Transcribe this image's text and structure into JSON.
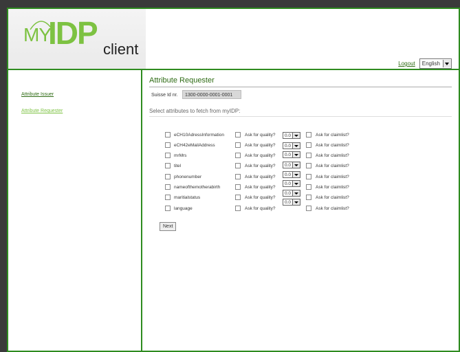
{
  "logo": {
    "my": "MY",
    "idp": "IDP",
    "client": "client"
  },
  "header": {
    "logout": "Logout",
    "language": "English"
  },
  "sidebar": {
    "items": [
      {
        "label": "Attribute Issuer"
      },
      {
        "label": "Attribute Requester"
      }
    ]
  },
  "main": {
    "title": "Attribute Requester",
    "suisse_label": "Suisse Id nr.",
    "suisse_value": "1300-0000-0001-0001",
    "select_text": "Select attributes to fetch from myIDP:",
    "quality_label": "Ask for quality?",
    "claimlist_label": "Ask for claimlist?",
    "attributes": [
      {
        "name": "eCH10AdressInformation",
        "quality": "0.0"
      },
      {
        "name": "eCH42eMailAddress",
        "quality": "0.0"
      },
      {
        "name": "mrMrs",
        "quality": "0.0"
      },
      {
        "name": "titel",
        "quality": "0.0"
      },
      {
        "name": "phonenumber",
        "quality": "0.0"
      },
      {
        "name": "nameofthemotherabirth",
        "quality": "0.0"
      },
      {
        "name": "maritialstatus",
        "quality": "0.0"
      },
      {
        "name": "language",
        "quality": "0.0"
      }
    ],
    "next": "Next"
  },
  "colors": {
    "accent": "#2e8b1f",
    "logo": "#7dc242"
  }
}
